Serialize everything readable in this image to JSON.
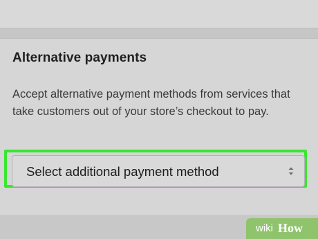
{
  "section": {
    "title": "Alternative payments",
    "description": "Accept alternative payment methods from services that take customers out of your store’s checkout to pay."
  },
  "payment_select": {
    "selected": "Select additional payment method",
    "icon": "up-down-chevron-icon"
  },
  "watermark": {
    "part1": "wiki",
    "part2": "How"
  },
  "colors": {
    "background": "#c9c9c9",
    "card": "#d6d6d6",
    "highlight": "#39e630",
    "watermark": "#8fc46d"
  }
}
